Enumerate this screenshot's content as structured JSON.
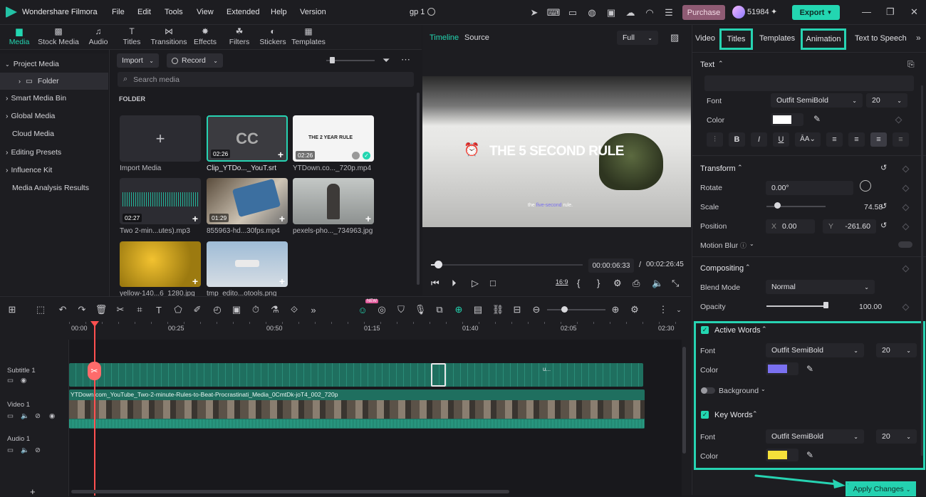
{
  "app": {
    "name": "Wondershare Filmora",
    "project": "gp 1",
    "credits": "51984",
    "purchase": "Purchase",
    "export": "Export"
  },
  "menu": [
    "File",
    "Edit",
    "Tools",
    "View",
    "Extended",
    "Help",
    "Version"
  ],
  "media_tabs": [
    {
      "label": "Media",
      "icon": "media-icon"
    },
    {
      "label": "Stock Media",
      "icon": "stock-media-icon"
    },
    {
      "label": "Audio",
      "icon": "audio-icon"
    },
    {
      "label": "Titles",
      "icon": "titles-icon"
    },
    {
      "label": "Transitions",
      "icon": "transitions-icon"
    },
    {
      "label": "Effects",
      "icon": "effects-icon"
    },
    {
      "label": "Filters",
      "icon": "filters-icon"
    },
    {
      "label": "Stickers",
      "icon": "stickers-icon"
    },
    {
      "label": "Templates",
      "icon": "templates-icon"
    }
  ],
  "sidebar": [
    "Project Media",
    "Folder",
    "Smart Media Bin",
    "Global Media",
    "Cloud Media",
    "Editing Presets",
    "Influence Kit",
    "Media Analysis Results"
  ],
  "media": {
    "import": "Import",
    "record": "Record",
    "search_placeholder": "Search media",
    "folder_label": "FOLDER",
    "items": [
      {
        "label": "Import Media",
        "duration": ""
      },
      {
        "label": "Clip_YTDo..._YouT.srt",
        "duration": "02:26"
      },
      {
        "label": "YTDown.co..._720p.mp4",
        "duration": "02:26"
      },
      {
        "label": "Two 2-min...utes).mp3",
        "duration": "02:27"
      },
      {
        "label": "855963-hd...30fps.mp4",
        "duration": "01:29"
      },
      {
        "label": "pexels-pho..._734963.jpg",
        "duration": ""
      },
      {
        "label": "yellow-140...6_1280.jpg",
        "duration": ""
      },
      {
        "label": "tmp_edito...otools.png",
        "duration": ""
      }
    ],
    "thumb_texts": {
      "cc": "CC",
      "rule": "THE 2 YEAR RULE"
    }
  },
  "preview": {
    "tabs": [
      "Timeline",
      "Source"
    ],
    "quality": "Full",
    "title_overlay": "THE 5 SECOND RULE",
    "subtitle_a": "the",
    "subtitle_b": "five-second",
    "subtitle_c": "rule.",
    "current_time": "00:00:06:33",
    "total_time": "00:02:26:45",
    "progress": 0.045
  },
  "right": {
    "tabs": [
      "Video",
      "Titles",
      "Templates",
      "Animation",
      "Text to Speech"
    ],
    "text_section": "Text",
    "font_label": "Font",
    "font": "Outfit SemiBold",
    "size": "20",
    "color_label": "Color",
    "transform": "Transform",
    "rotate_label": "Rotate",
    "rotate": "0.00°",
    "scale_label": "Scale",
    "scale": "74.58",
    "scale_level": 0.18,
    "position_label": "Position",
    "pos_x_label": "X",
    "pos_x": "0.00",
    "pos_y_label": "Y",
    "pos_y": "-261.60",
    "motion_blur": "Motion Blur",
    "compositing": "Compositing",
    "blend_label": "Blend Mode",
    "blend": "Normal",
    "opacity_label": "Opacity",
    "opacity": "100.00",
    "opacity_level": 1.0,
    "active_words": "Active Words",
    "active_font": "Outfit SemiBold",
    "active_size": "20",
    "active_color": "#7a70f0",
    "background": "Background",
    "key_words": "Key Words",
    "key_font": "Outfit SemiBold",
    "key_size": "20",
    "key_color": "#f5e13a",
    "apply": "Apply Changes"
  },
  "timeline": {
    "ticks": [
      "00:00",
      "00:25",
      "00:50",
      "01:15",
      "01:40",
      "02:05",
      "02:30"
    ],
    "tracks": [
      "Subtitle 1",
      "Video 1",
      "Audio 1"
    ],
    "video_clip": "YTDown.com_YouTube_Two-2-minute-Rules-to-Beat-Procrastinati_Media_0CmtDk-joT4_002_720p",
    "subtitle_snippet": "u...",
    "badge": "NEW"
  },
  "colors": {
    "accent": "#23d6b1",
    "purchase": "#8f5b74"
  }
}
